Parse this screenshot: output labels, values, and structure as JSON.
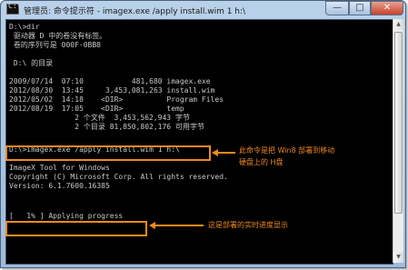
{
  "window": {
    "title": "管理员: 命令提示符 - imagex.exe  /apply install.wim 1 h:\\"
  },
  "title_icon": {
    "glyph": "C:\\"
  },
  "window_buttons": {
    "minimize": "—",
    "maximize": "□",
    "close": "✕"
  },
  "console": {
    "lines": [
      "D:\\>dir",
      " 驱动器 D 中的卷没有标签。",
      " 卷的序列号是 000F-0BB8",
      "",
      " D:\\ 的目录",
      "",
      "2009/07/14  07:10           481,680 imagex.exe",
      "2012/08/30  13:45     3,453,081,263 install.wim",
      "2012/05/02  14:18    <DIR>          Program Files",
      "2012/08/19  17:05    <DIR>          temp",
      "               2 个文件  3,453,562,943 字节",
      "               2 个目录 81,850,802,176 可用字节",
      "",
      "D:\\>imagex.exe /apply install.wim 1 h:\\",
      "",
      "ImageX Tool for Windows",
      "Copyright (C) Microsoft Corp. All rights reserved.",
      "Version: 6.1.7600.16385",
      "",
      "",
      "[   1% ] Applying progress"
    ]
  },
  "annotations": {
    "command_note_line1": "此命令是把 Win8 部署到移动",
    "command_note_line2": "硬盘上的 H盘",
    "progress_note": "这是部署的实时进度显示"
  },
  "colors": {
    "accent": "#f08a1c",
    "console_bg": "#000000",
    "console_text": "#c8c8c8"
  }
}
